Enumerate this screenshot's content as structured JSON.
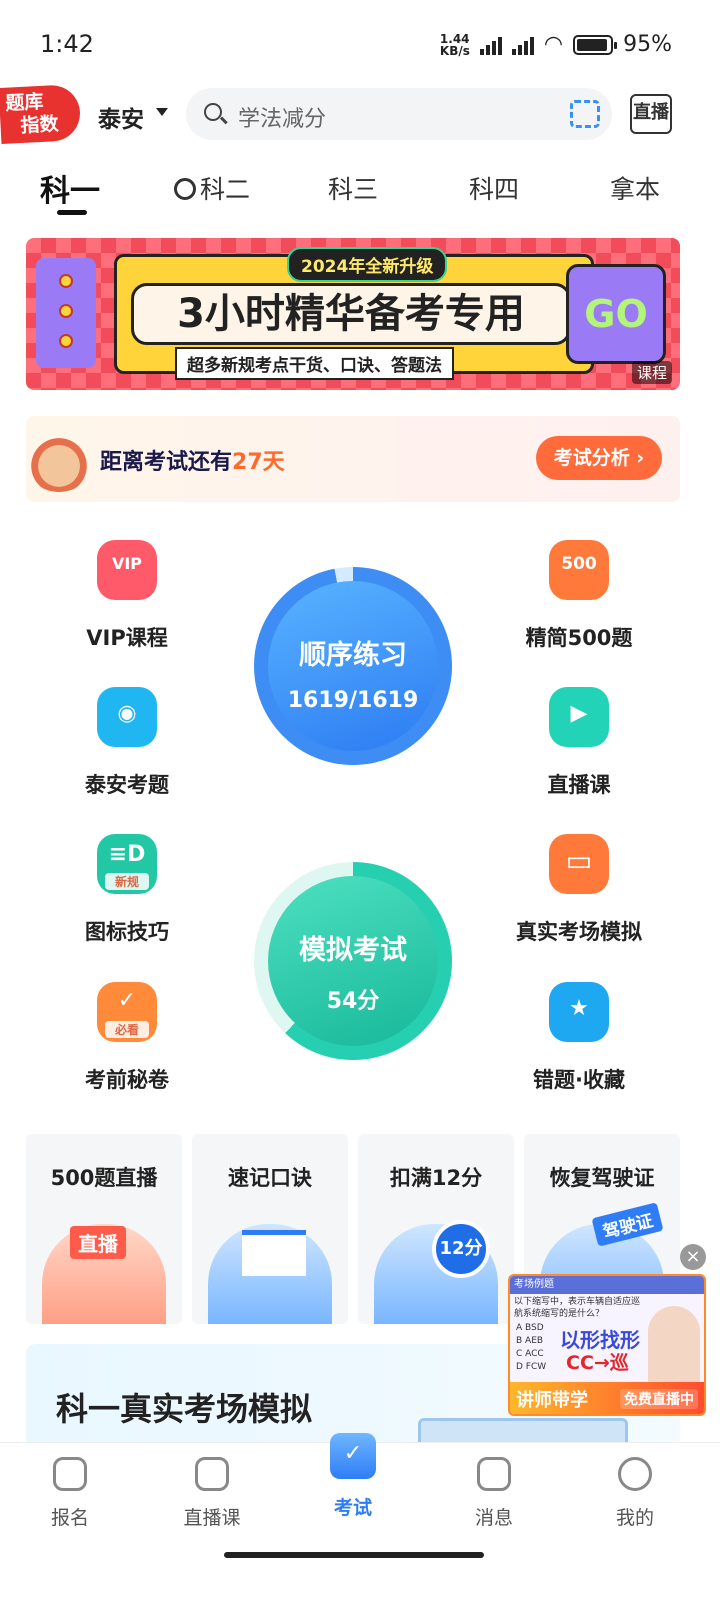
{
  "status_bar": {
    "time": "1:42",
    "net_speed": "1.44\nKB/s",
    "battery": "95%"
  },
  "header": {
    "logo_line1": "题库",
    "logo_line2": "指数",
    "city": "泰安",
    "search_placeholder": "学法减分",
    "live_label": "直播"
  },
  "tabs": [
    {
      "label": "科一",
      "active": true
    },
    {
      "label": "科二"
    },
    {
      "label": "科三"
    },
    {
      "label": "科四"
    },
    {
      "label": "拿本"
    }
  ],
  "banner": {
    "pill": "2024年全新升级",
    "title": "3小时精华备考专用",
    "subtitle": "超多新规考点干货、口诀、答题法",
    "go": "GO",
    "tag": "课程"
  },
  "countdown": {
    "prefix": "距离考试还有",
    "days": "27天",
    "button": "考试分析 ›"
  },
  "features_left": [
    {
      "label": "VIP课程",
      "icon": "vip-bag-icon",
      "glyph": "VIP",
      "color": "#ff5a6a"
    },
    {
      "label": "泰安考题",
      "icon": "map-pin-icon",
      "glyph": "◉",
      "color": "#1fb6f2"
    },
    {
      "label": "图标技巧",
      "icon": "sign-icon",
      "glyph": "≡D",
      "mini": "新规",
      "color": "#22c7a4"
    },
    {
      "label": "考前秘卷",
      "icon": "secret-paper-icon",
      "glyph": "✓",
      "mini": "必看",
      "color": "#ff8a3a"
    }
  ],
  "features_right": [
    {
      "label": "精简500题",
      "icon": "500-icon",
      "glyph": "500",
      "color": "#ff7a3a"
    },
    {
      "label": "直播课",
      "icon": "video-icon",
      "glyph": "▶",
      "color": "#22d3b8"
    },
    {
      "label": "真实考场模拟",
      "icon": "monitor-icon",
      "glyph": "▭",
      "color": "#ff7a3a"
    },
    {
      "label": "错题·收藏",
      "icon": "bookmark-star-icon",
      "glyph": "★",
      "color": "#1fa8f2"
    }
  ],
  "practice": {
    "title": "顺序练习",
    "progress": "1619/1619"
  },
  "mock": {
    "title": "模拟考试",
    "score": "54分"
  },
  "cards": [
    {
      "title": "500题直播",
      "badge": "直播"
    },
    {
      "title": "速记口诀"
    },
    {
      "title": "扣满12分",
      "badge": "12分"
    },
    {
      "title": "恢复驾驶证",
      "badge": "驾驶证"
    }
  ],
  "simulation": {
    "title": "科一真实考场模拟"
  },
  "float_ad": {
    "header": "考场例题",
    "question": "以下缩写中，表示车辆自适应巡航系统缩写的是什么？",
    "options": [
      "A BSD",
      "B AEB",
      "C ACC",
      "D FCW"
    ],
    "big": "以形找形",
    "cc": "CC→巡",
    "foot_left": "讲师带学",
    "foot_right": "免费直播中"
  },
  "bottom_nav": [
    {
      "label": "报名",
      "icon": "signup-icon"
    },
    {
      "label": "直播课",
      "icon": "tv-icon"
    },
    {
      "label": "考试",
      "icon": "exam-folder-icon",
      "active": true
    },
    {
      "label": "消息",
      "icon": "message-icon"
    },
    {
      "label": "我的",
      "icon": "profile-icon"
    }
  ]
}
